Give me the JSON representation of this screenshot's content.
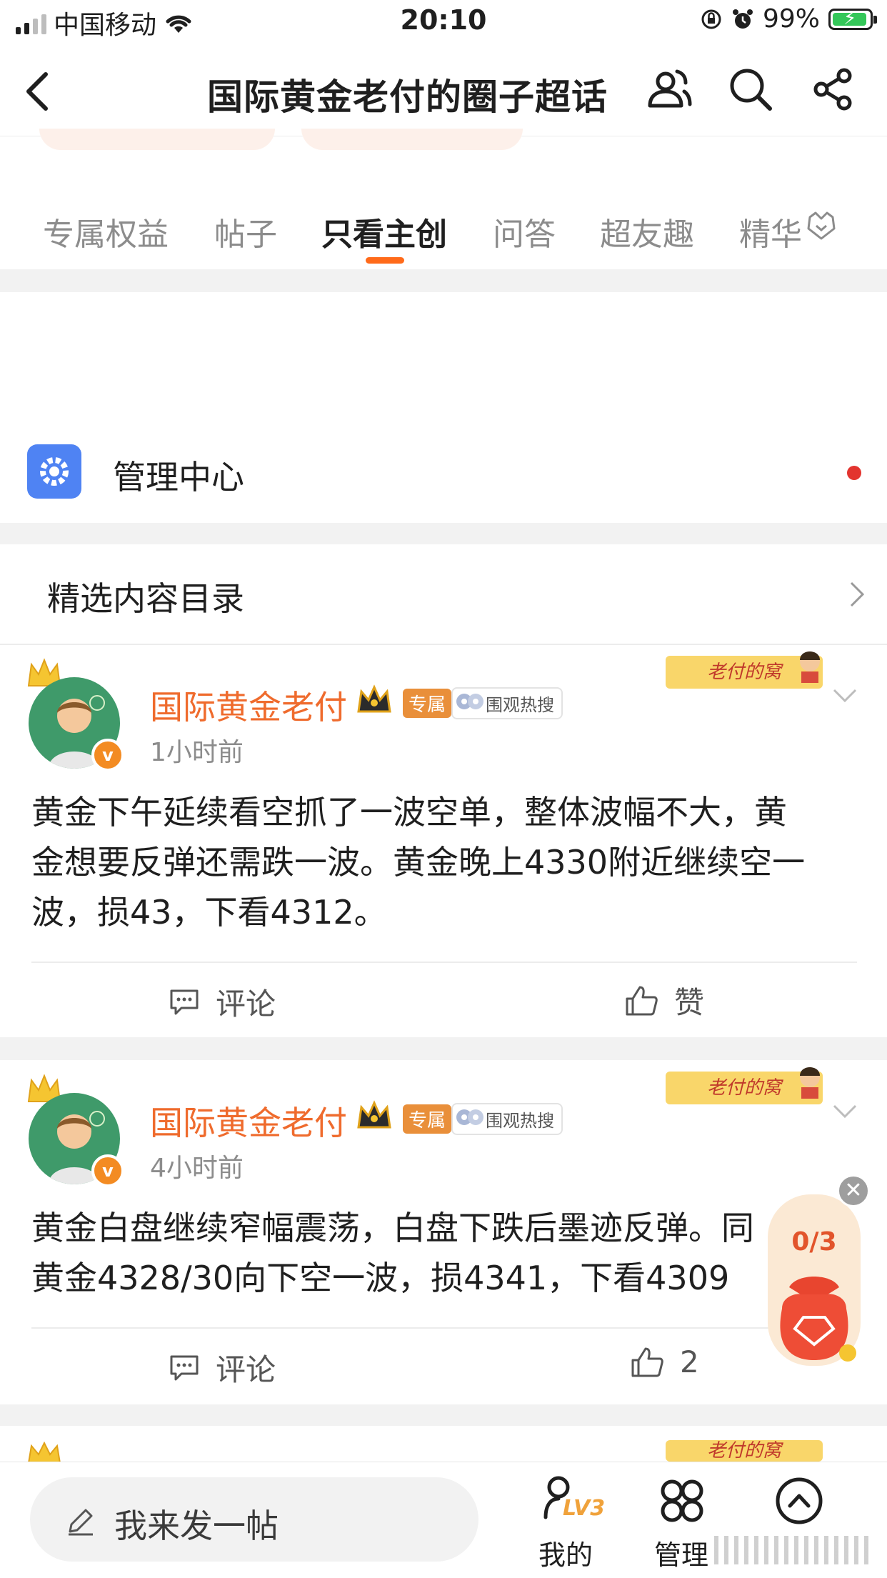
{
  "status_bar": {
    "carrier": "中国移动",
    "time": "20:10",
    "battery": "99%"
  },
  "nav": {
    "title": "国际黄金老付的圈子超话"
  },
  "tabs": [
    "专属权益",
    "帖子",
    "只看主创",
    "问答",
    "超友趣",
    "精华"
  ],
  "tabs_active_index": 2,
  "manage": {
    "label": "管理中心"
  },
  "catalog": {
    "label": "精选内容目录"
  },
  "posts": [
    {
      "author": "国际黄金老付",
      "tag_exclusive": "专属",
      "tag_hot": "围观热搜",
      "banner": "老付的窝",
      "time": "1小时前",
      "lines": [
        "黄金下午延续看空抓了一波空单，整体波幅不大，黄",
        "金想要反弹还需跌一波。黄金晚上4330附近继续空一",
        "波，损43，下看4312。"
      ],
      "comment_label": "评论",
      "like_label": "赞"
    },
    {
      "author": "国际黄金老付",
      "tag_exclusive": "专属",
      "tag_hot": "围观热搜",
      "banner": "老付的窝",
      "time": "4小时前",
      "lines": [
        "黄金白盘继续窄幅震荡，白盘下跌后墨迹反弹。同",
        "黄金4328/30向下空一波，损4341，下看4309"
      ],
      "comment_label": "评论",
      "like_label": "2"
    }
  ],
  "third_post_banner": "老付的窝",
  "floating": {
    "progress": "0/3"
  },
  "bottom": {
    "compose_placeholder": "我来发一帖",
    "mine_label": "我的",
    "mine_level": "LV3",
    "manage_label": "管理"
  },
  "colors": {
    "accent": "#ff6a1a",
    "username": "#ef6b2d",
    "gear_bg": "#4f83f3"
  }
}
